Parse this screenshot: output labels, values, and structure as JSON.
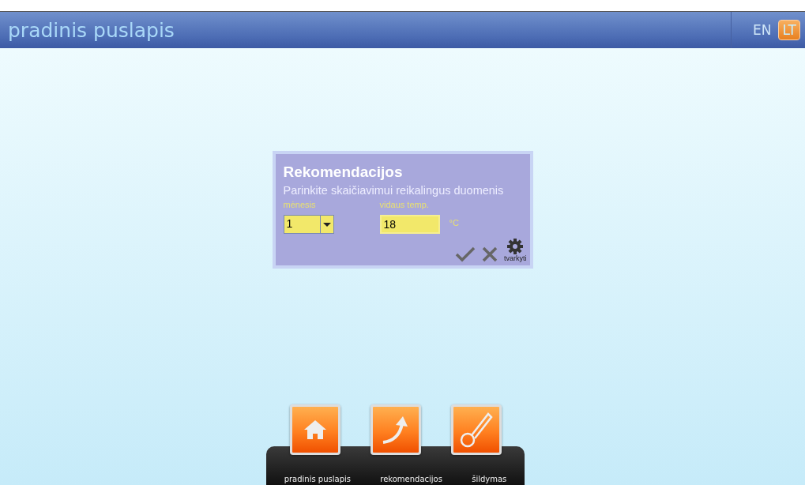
{
  "header": {
    "title": "pradinis puslapis",
    "languages": [
      {
        "label": "EN",
        "selected": false
      },
      {
        "label": "LT",
        "selected": true
      }
    ]
  },
  "dialog": {
    "title": "Rekomendacijos",
    "subtitle": "Parinkite skaičiavimui reikalingus duomenis",
    "month": {
      "label": "mėnesis",
      "value": "1"
    },
    "temperature": {
      "label": "vidaus temp.",
      "value": "18",
      "unit": "°C"
    },
    "edit_label": "tvarkyti"
  },
  "dock": [
    {
      "kind": "home",
      "label": "pradinis puslapis"
    },
    {
      "kind": "arrow",
      "label": "rekomendacijos"
    },
    {
      "kind": "thermometer",
      "label": "šildymas"
    }
  ]
}
